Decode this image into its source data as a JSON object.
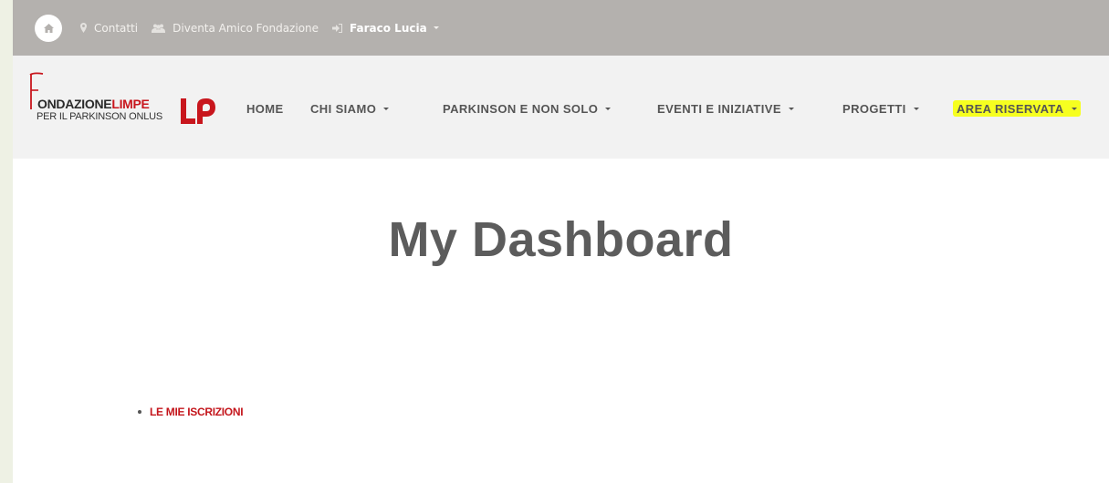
{
  "topbar": {
    "home_icon": "home-icon",
    "contacts_label": "Contatti",
    "contacts_icon": "map-pin-icon",
    "friend_label": "Diventa Amico Fondazione",
    "friend_icon": "users-icon",
    "user_label": "Faraco Lucia",
    "user_icon": "sign-in-icon"
  },
  "logo": {
    "line1_a": "ONDAZIONE",
    "line1_b": "LIMPE",
    "line2": "PER IL PARKINSON ONLUS",
    "brand_color": "#c8161d"
  },
  "nav": {
    "items": [
      {
        "label": "HOME"
      },
      {
        "label": "CHI SIAMO"
      },
      {
        "label": "PARKINSON E NON SOLO"
      },
      {
        "label": "EVENTI E INIZIATIVE"
      },
      {
        "label": "PROGETTI"
      },
      {
        "label": "AREA RISERVATA"
      }
    ],
    "highlight_color": "#f6ff20"
  },
  "main": {
    "title": "My Dashboard",
    "links": [
      {
        "label": "LE MIE ISCRIZIONI"
      }
    ],
    "link_color": "#c4161c"
  }
}
